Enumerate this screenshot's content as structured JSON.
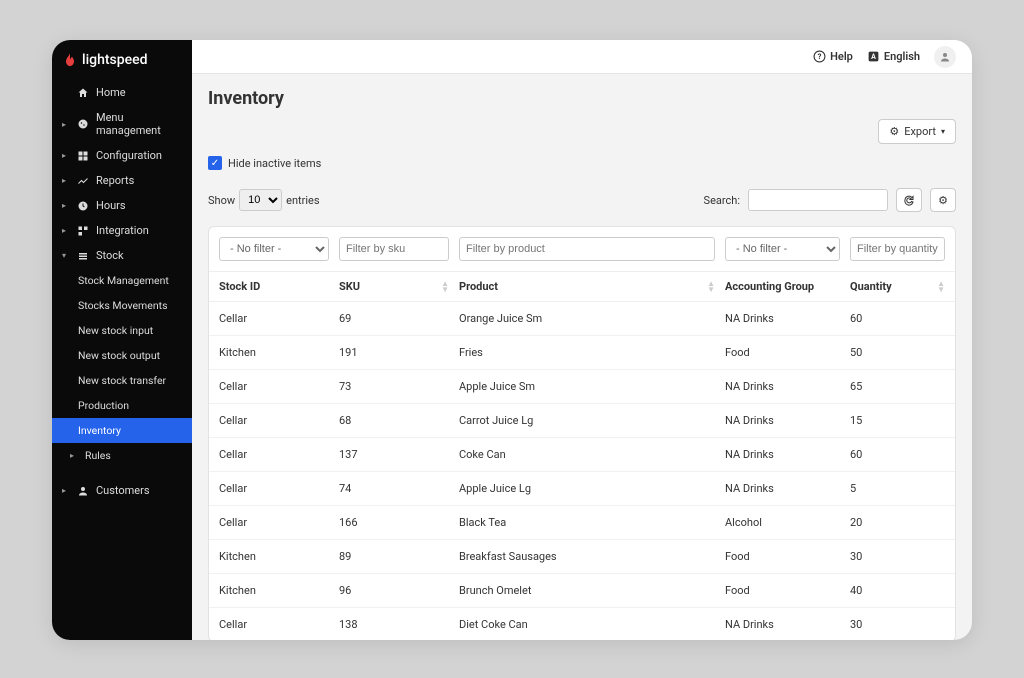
{
  "brand": "lightspeed",
  "topbar": {
    "help": "Help",
    "language": "English"
  },
  "sidebar": {
    "items": [
      {
        "label": "Home",
        "icon": "home"
      },
      {
        "label": "Menu management",
        "icon": "cookie",
        "caret": true
      },
      {
        "label": "Configuration",
        "icon": "grid",
        "caret": true
      },
      {
        "label": "Reports",
        "icon": "chart",
        "caret": true
      },
      {
        "label": "Hours",
        "icon": "clock",
        "caret": true
      },
      {
        "label": "Integration",
        "icon": "blocks",
        "caret": true
      },
      {
        "label": "Stock",
        "icon": "stock",
        "caret": true,
        "expanded": true
      }
    ],
    "stock_children": [
      "Stock Management",
      "Stocks Movements",
      "New stock input",
      "New stock output",
      "New stock transfer",
      "Production",
      "Inventory",
      "Rules"
    ],
    "customers": "Customers"
  },
  "page": {
    "title": "Inventory",
    "export_label": "Export",
    "hide_inactive": "Hide inactive items",
    "show_label": "Show",
    "entries_label": "entries",
    "entries_value": "10",
    "search_label": "Search:",
    "no_filter": "- No filter -",
    "filter_sku_placeholder": "Filter by sku",
    "filter_product_placeholder": "Filter by product",
    "filter_quantity_placeholder": "Filter by quantity",
    "headers": {
      "stock_id": "Stock ID",
      "sku": "SKU",
      "product": "Product",
      "group": "Accounting Group",
      "quantity": "Quantity"
    },
    "rows": [
      {
        "stock": "Cellar",
        "sku": "69",
        "product": "Orange Juice Sm",
        "group": "NA Drinks",
        "qty": "60"
      },
      {
        "stock": "Kitchen",
        "sku": "191",
        "product": "Fries",
        "group": "Food",
        "qty": "50"
      },
      {
        "stock": "Cellar",
        "sku": "73",
        "product": "Apple Juice Sm",
        "group": "NA Drinks",
        "qty": "65"
      },
      {
        "stock": "Cellar",
        "sku": "68",
        "product": "Carrot Juice Lg",
        "group": "NA Drinks",
        "qty": "15"
      },
      {
        "stock": "Cellar",
        "sku": "137",
        "product": "Coke Can",
        "group": "NA Drinks",
        "qty": "60"
      },
      {
        "stock": "Cellar",
        "sku": "74",
        "product": "Apple Juice Lg",
        "group": "NA Drinks",
        "qty": "5"
      },
      {
        "stock": "Cellar",
        "sku": "166",
        "product": "Black Tea",
        "group": "Alcohol",
        "qty": "20"
      },
      {
        "stock": "Kitchen",
        "sku": "89",
        "product": "Breakfast Sausages",
        "group": "Food",
        "qty": "30"
      },
      {
        "stock": "Kitchen",
        "sku": "96",
        "product": "Brunch Omelet",
        "group": "Food",
        "qty": "40"
      },
      {
        "stock": "Cellar",
        "sku": "138",
        "product": "Diet Coke Can",
        "group": "NA Drinks",
        "qty": "30"
      }
    ]
  }
}
